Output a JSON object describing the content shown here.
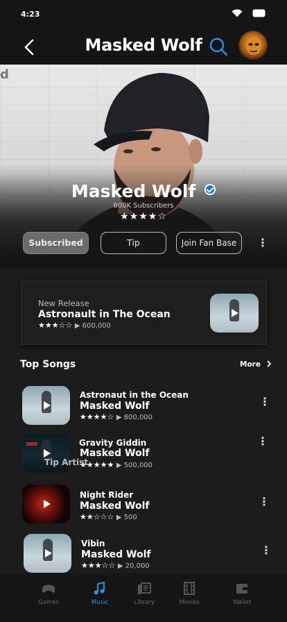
{
  "status_bar": {
    "time": "4:23"
  },
  "header": {
    "title": "Masked Wolf"
  },
  "hero": {
    "artist_name": "Masked Wolf",
    "subscribers": "600K Subscribers",
    "rating_stars": "★★★★☆",
    "backdrop_letter": "d"
  },
  "actions": {
    "subscribed_label": "Subscribed",
    "tip_label": "Tip",
    "fan_base_label": "Join Fan Base",
    "more_icon": "⋮"
  },
  "new_release": {
    "label": "New Release",
    "title": "Astronault in The Ocean",
    "stars": "★★★☆☆",
    "plays": "▶ 600,000"
  },
  "top_songs": {
    "title": "Top Songs",
    "more_label": "More",
    "overlay_text": "Tip Artist",
    "items": [
      {
        "title": "Astronaut in the Ocean",
        "artist": "Masked Wolf",
        "stars": "★★★★☆",
        "plays": "▶ 800,000"
      },
      {
        "title": "Gravity Giddin",
        "artist": "Masked Wolf",
        "stars": "★★★★★",
        "plays": "▶ 500,000"
      },
      {
        "title": "Night Rider",
        "artist": "Masked Wolf",
        "stars": "★★☆☆☆",
        "plays": "▶ 500"
      },
      {
        "title": "Vibin",
        "artist": "Masked Wolf",
        "stars": "★★★☆☆",
        "plays": "▶ 20,000"
      }
    ]
  },
  "bottom_nav": {
    "items": [
      {
        "label": "Games",
        "icon": "gamepad-icon"
      },
      {
        "label": "Music",
        "icon": "music-note-icon"
      },
      {
        "label": "Library",
        "icon": "library-icon"
      },
      {
        "label": "Movies",
        "icon": "film-icon"
      },
      {
        "label": "Wallet",
        "icon": "wallet-icon"
      }
    ],
    "active_color": "#2f8fe0"
  },
  "colors": {
    "accent": "#1e73be",
    "background": "#151515"
  }
}
